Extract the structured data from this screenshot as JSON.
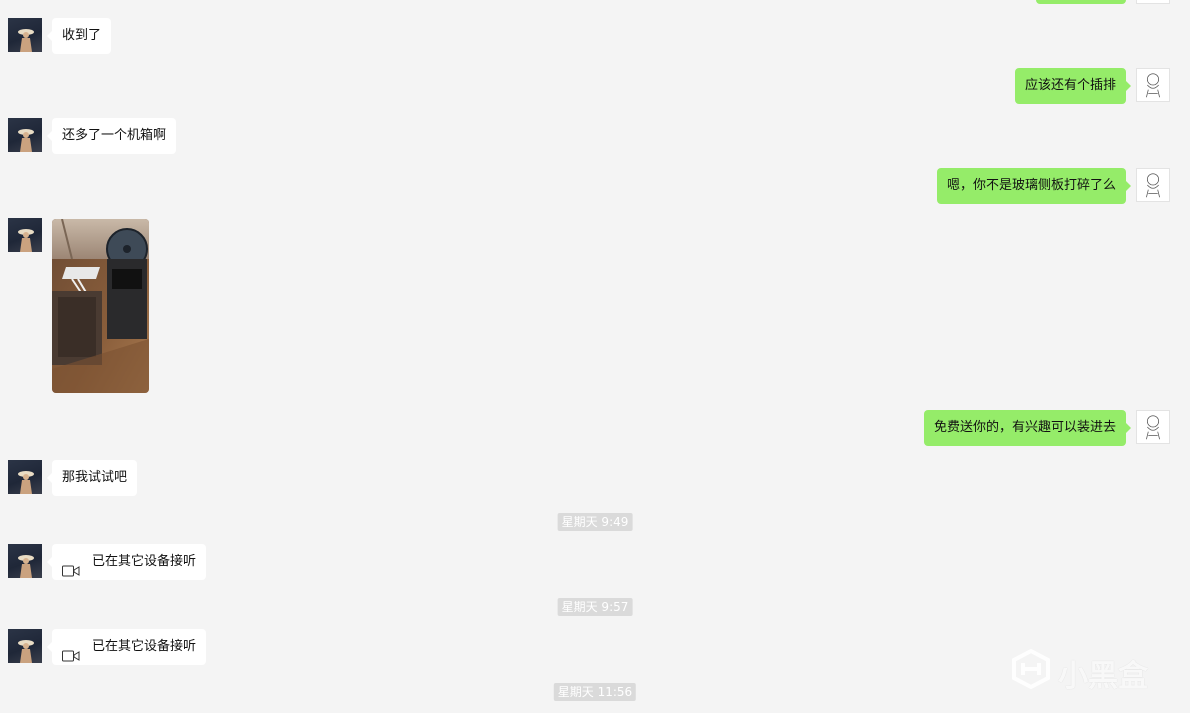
{
  "messages": {
    "m1": "收到了",
    "m2": "应该还有个插排",
    "m3": "还多了一个机箱啊",
    "m4": "嗯，你不是玻璃侧板打碎了么",
    "m6": "免费送你的，有兴趣可以装进去",
    "m7": "那我试试吧",
    "call1": "已在其它设备接听",
    "call2": "已在其它设备接听"
  },
  "timestamps": {
    "t1": "星期天 9:49",
    "t2": "星期天 9:57",
    "t3": "星期天 11:56"
  },
  "photo": {
    "description_icon": "image-thumbnail"
  },
  "icons": {
    "call": "video-call-icon",
    "watermark": "xiaoheihe-logo"
  },
  "watermark": {
    "text": "小黑盒"
  },
  "colors": {
    "background": "#f4f4f4",
    "incoming_bubble": "#ffffff",
    "outgoing_bubble": "#95ec69",
    "timestamp_bg": "#dadada"
  }
}
